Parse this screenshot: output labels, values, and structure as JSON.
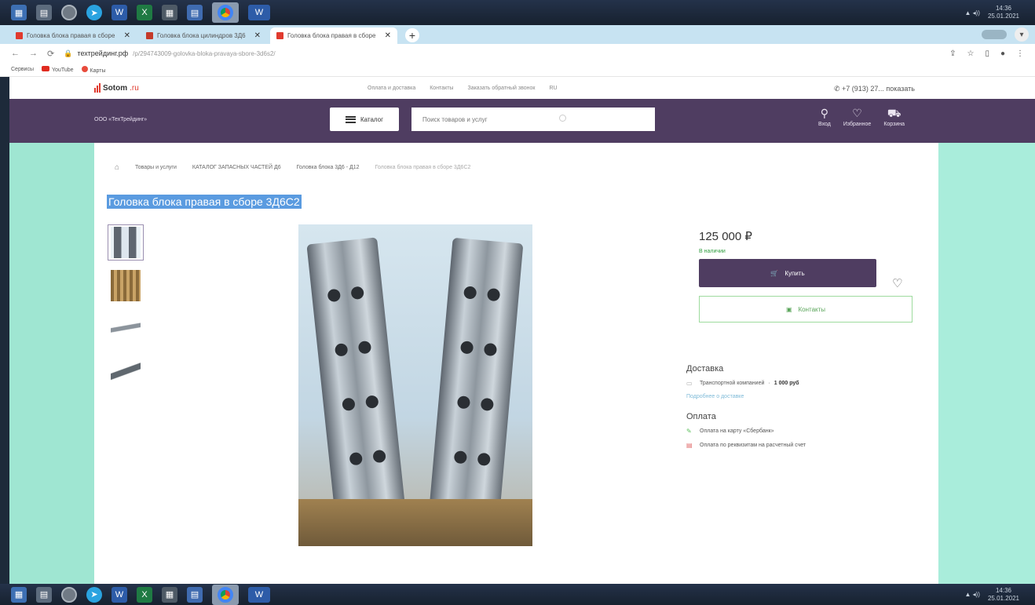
{
  "taskbar": {
    "time": "14:36",
    "date": "25.01.2021"
  },
  "tabs": [
    {
      "title": "Головка блока правая в сборе"
    },
    {
      "title": "Головка блока цилиндров 3Д6"
    },
    {
      "title": "Головка блока правая в сборе"
    }
  ],
  "address": {
    "host": "техтрейдинг.рф",
    "path": "/p/294743009-golovka-bloka-pravaya-sbore-3d6s2/"
  },
  "bookmarks": [
    {
      "label": "Сервисы"
    },
    {
      "label": "YouTube"
    },
    {
      "label": "Карты"
    }
  ],
  "site": {
    "logo": "Sotom",
    "logo_tld": ".ru",
    "top_links": [
      "Оплата и доставка",
      "Контакты",
      "Заказать обратный звонок",
      "RU"
    ],
    "phone": "+7 (913) 27... показать",
    "company": "ООО «ТехТрейдинг»",
    "catalog_label": "Каталог",
    "search_placeholder": "Поиск товаров и услуг",
    "actions": [
      {
        "label": "Вход",
        "icon": "user-icon"
      },
      {
        "label": "Избранное",
        "icon": "heart-icon"
      },
      {
        "label": "Корзина",
        "icon": "cart-icon"
      }
    ]
  },
  "breadcrumb": [
    "Товары и услуги",
    "КАТАЛОГ ЗАПАСНЫХ ЧАСТЕЙ Д6",
    "Головка блока 3Д6 - Д12",
    "Головка блока правая в сборе 3Д6С2"
  ],
  "product": {
    "title": "Головка блока правая в сборе 3Д6С2",
    "price": "125 000 ₽",
    "stock": "В наличии",
    "buy_label": "Купить",
    "contacts_label": "Контакты"
  },
  "delivery": {
    "title": "Доставка",
    "method": "Транспортной компанией",
    "cost": "1 000 руб",
    "more": "Подробнее о доставке"
  },
  "payment": {
    "title": "Оплата",
    "items": [
      "Оплата на карту «Сбербанк»",
      "Оплата по реквизитам на расчетный счет"
    ]
  }
}
